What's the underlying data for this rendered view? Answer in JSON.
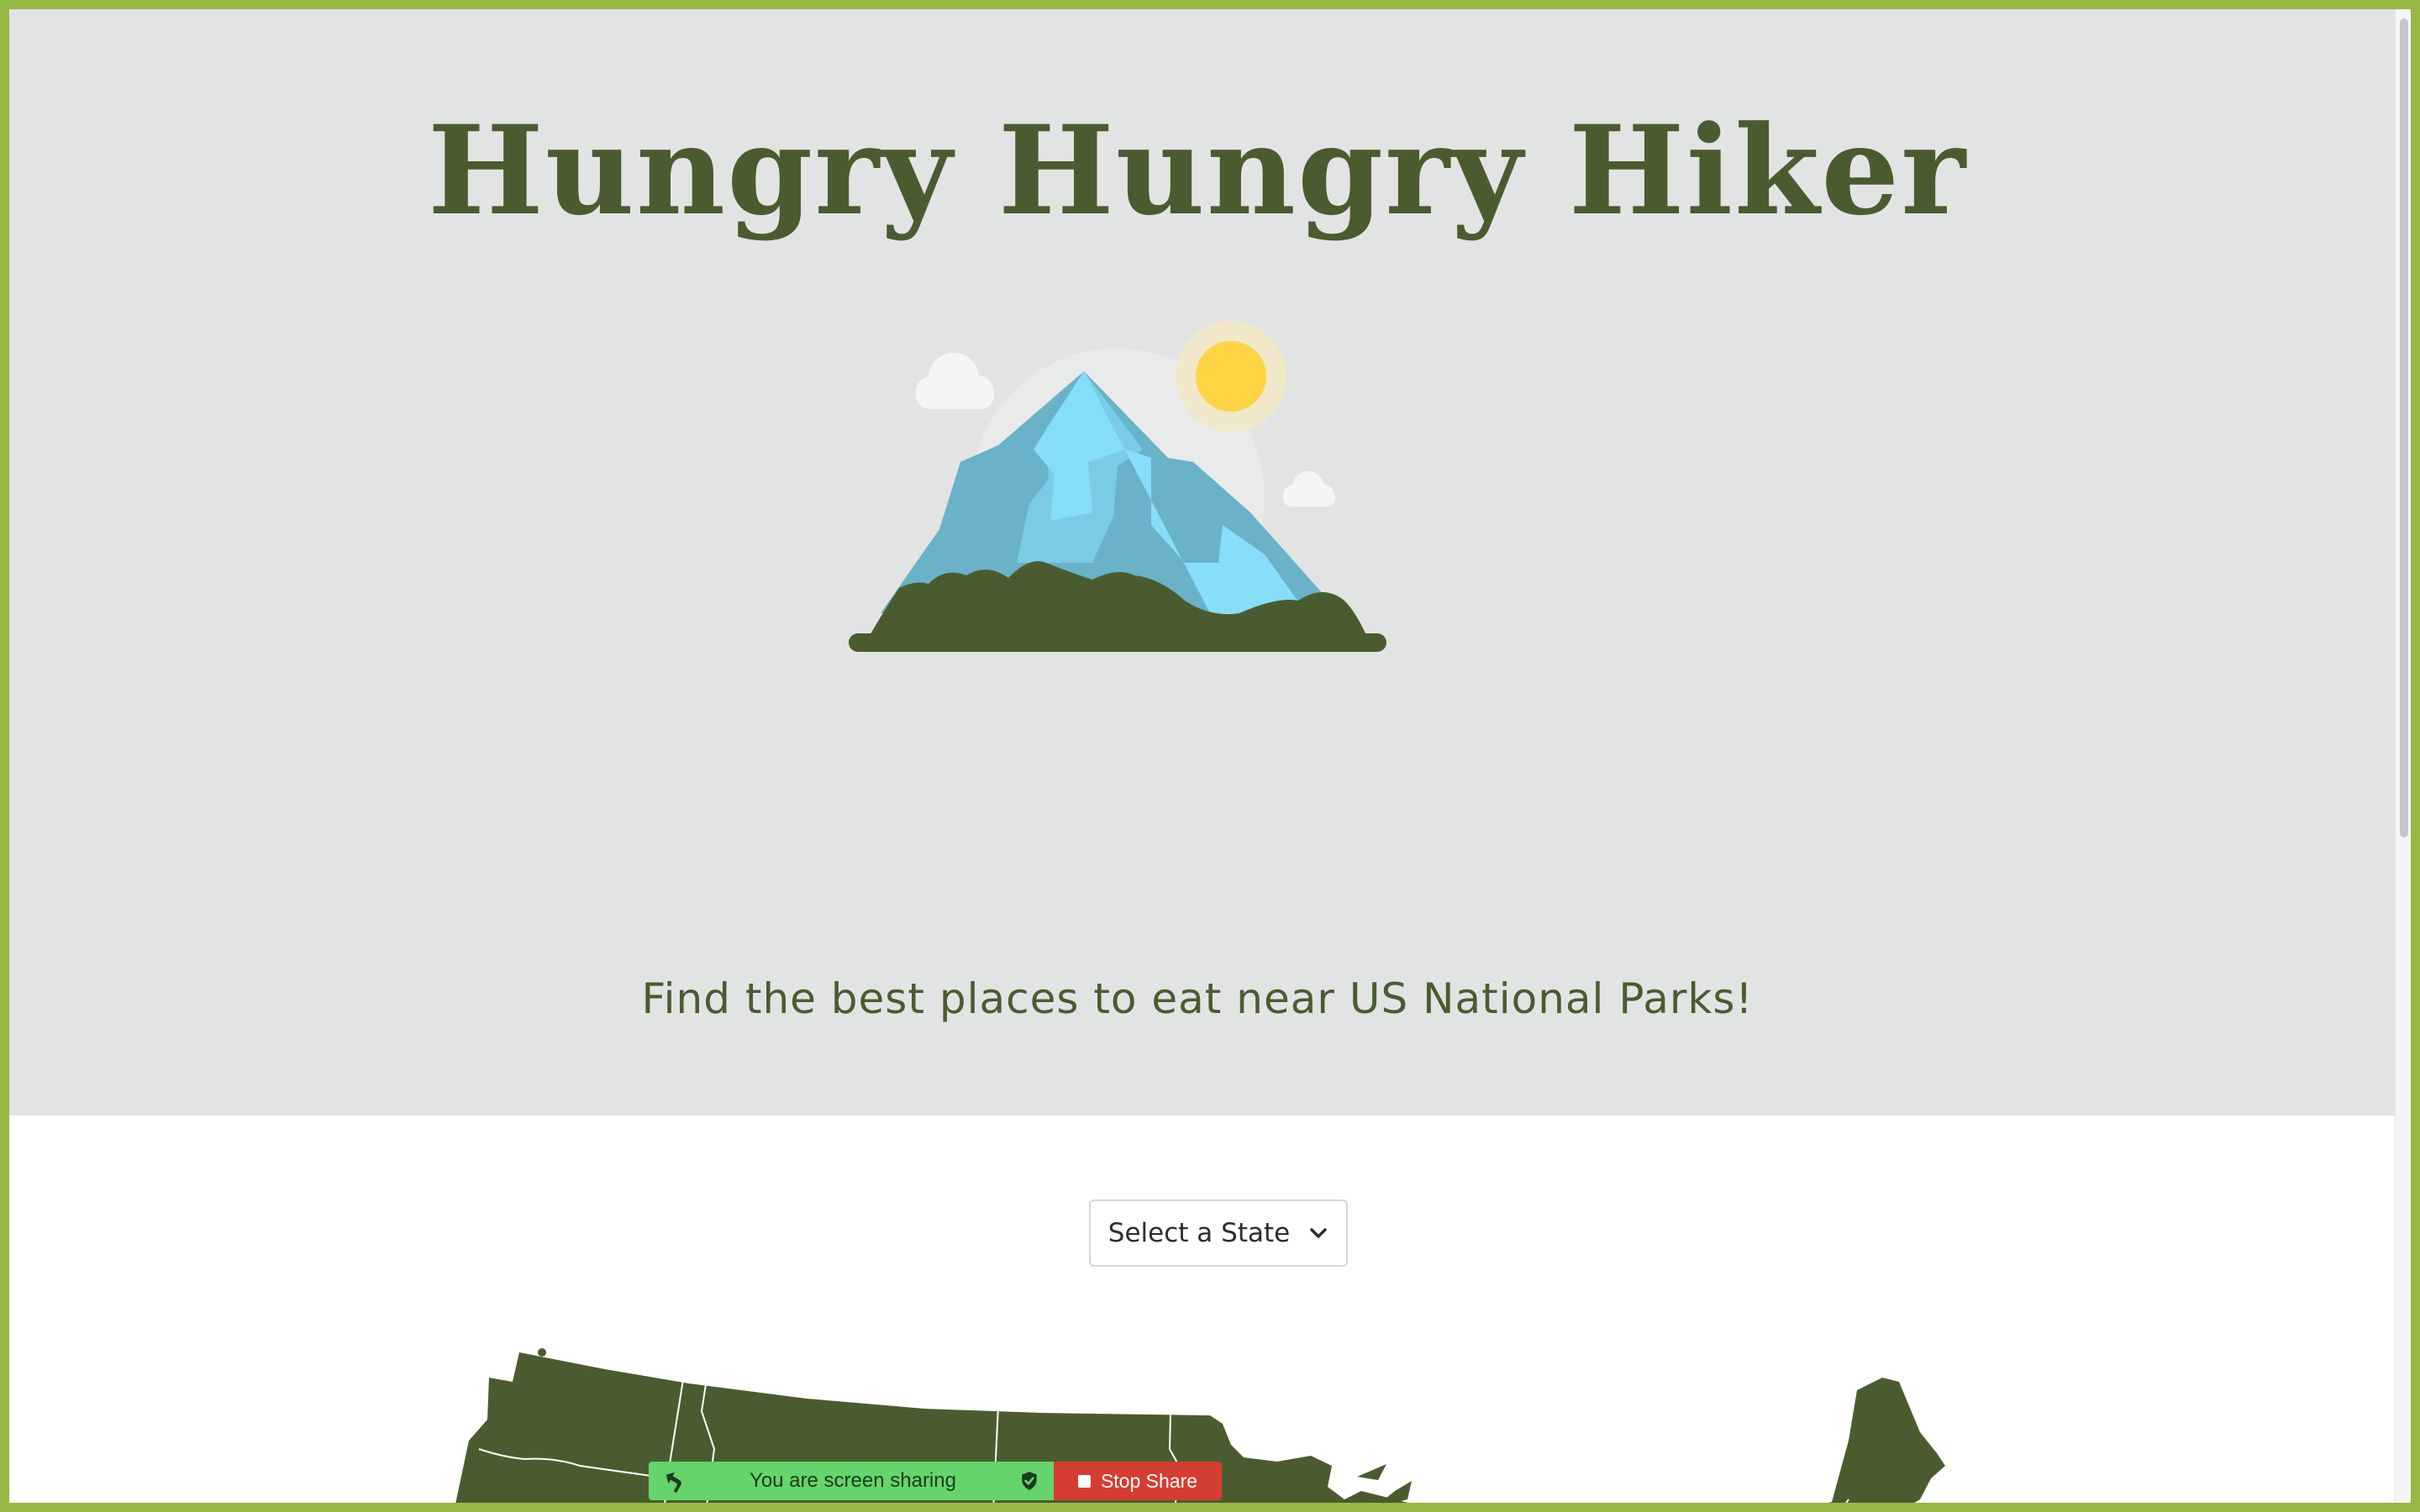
{
  "hero": {
    "title": "Hungry Hungry Hiker",
    "tagline": "Find the best places to eat near US National Parks!",
    "illustration_icon": "mountain-sun-icon"
  },
  "state_select": {
    "label": "Select a State",
    "icon": "chevron-down-icon"
  },
  "map": {
    "icon": "us-states-map"
  },
  "screen_share": {
    "status_label": "You are screen sharing",
    "stop_label": "Stop Share",
    "icons": [
      "share-arrow-icon",
      "shield-check-icon",
      "stop-icon"
    ]
  },
  "colors": {
    "brand_green": "#4a5c2f",
    "hero_background": "#e2e4e3",
    "share_border": "#95b844",
    "share_green": "#65d46b",
    "stop_red": "#d43d32",
    "ice_light": "#86def8",
    "ice_dark": "#69b2c8",
    "sun": "#fdd444"
  }
}
